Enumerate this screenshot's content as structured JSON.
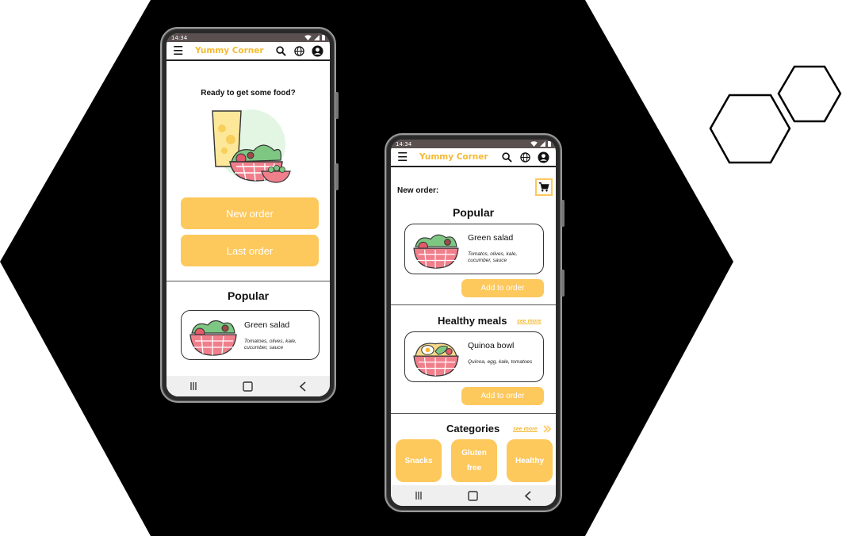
{
  "colors": {
    "accent": "#fdc85c",
    "brand_text": "#f5b932",
    "status_bar": "#5a5050",
    "background_shape": "#000000"
  },
  "status_time": "14:34",
  "app_title": "Yummy Corner",
  "icons": [
    "menu-icon",
    "search-icon",
    "globe-icon",
    "account-icon",
    "cart-icon",
    "wifi-icon",
    "signal-icon",
    "battery-icon",
    "recents-icon",
    "home-icon",
    "back-icon",
    "chevron-double-right-icon"
  ],
  "phone1": {
    "greeting": "Ready to get some food?",
    "new_order": "New order",
    "last_order": "Last order",
    "popular_title": "Popular",
    "item": {
      "name": "Green salad",
      "desc_line1": "Tomatoes, olives, kale,",
      "desc_line2": "cucumber, sauce"
    }
  },
  "phone2": {
    "heading": "New order:",
    "popular_title": "Popular",
    "item1": {
      "name": "Green salad",
      "desc_line1": "Tomatos, olives, kale,",
      "desc_line2": "cucumber, sauce",
      "button": "Add to order"
    },
    "healthy_title": "Healthy meals",
    "healthy_see_more": "see more",
    "item2": {
      "name": "Quinoa bowl",
      "desc": "Quinoa, egg, kale, tomatoes",
      "button": "Add to order"
    },
    "categories_title": "Categories",
    "categories_see_more": "see more",
    "categories": [
      {
        "line1": "Snacks",
        "line2": ""
      },
      {
        "line1": "Gluten",
        "line2": "free"
      },
      {
        "line1": "Healthy",
        "line2": ""
      }
    ]
  }
}
